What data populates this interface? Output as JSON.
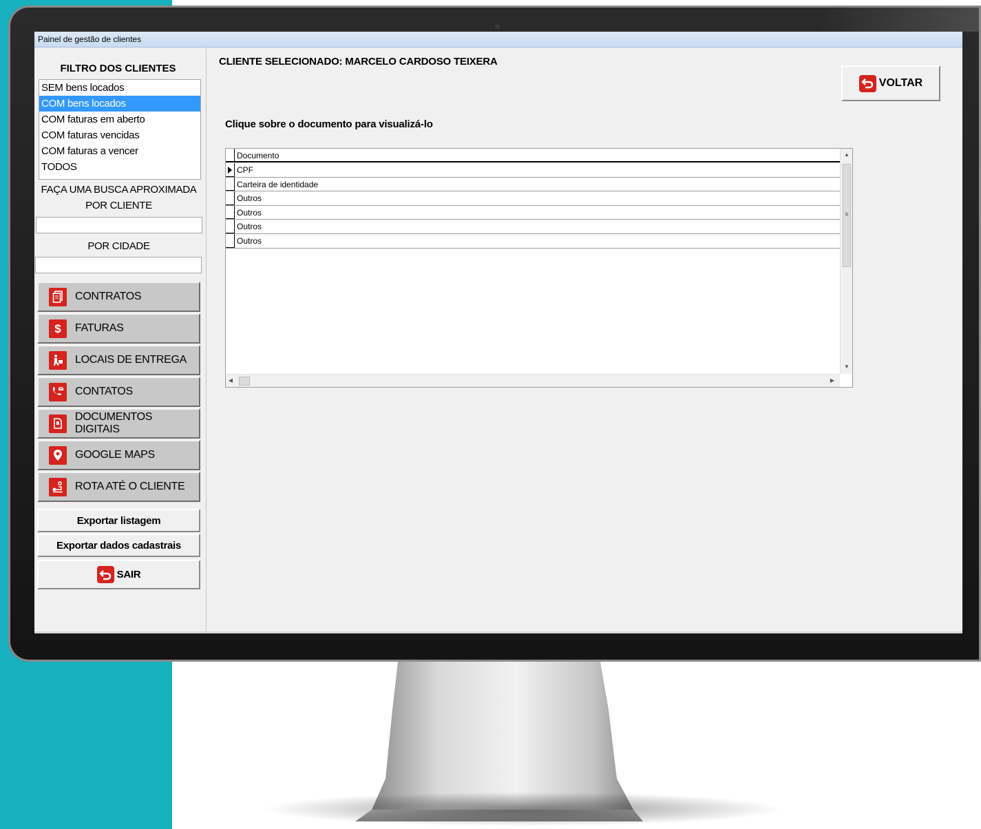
{
  "window": {
    "title": "Painel de gestão de clientes"
  },
  "filter": {
    "title": "FILTRO DOS CLIENTES",
    "items": [
      {
        "label": "SEM bens locados",
        "selected": false
      },
      {
        "label": "COM bens locados",
        "selected": true
      },
      {
        "label": "COM faturas em aberto",
        "selected": false
      },
      {
        "label": "COM faturas vencidas",
        "selected": false
      },
      {
        "label": "COM faturas a vencer",
        "selected": false
      },
      {
        "label": "TODOS",
        "selected": false
      }
    ]
  },
  "search": {
    "label_line1": "FAÇA UMA BUSCA APROXIMADA",
    "label_line2": "POR CLIENTE",
    "client_value": "",
    "city_label": "POR CIDADE",
    "city_value": ""
  },
  "nav": [
    {
      "label": "CONTRATOS",
      "icon": "contract-icon"
    },
    {
      "label": "FATURAS",
      "icon": "dollar-icon"
    },
    {
      "label": "LOCAIS DE ENTREGA",
      "icon": "delivery-icon"
    },
    {
      "label": "CONTATOS",
      "icon": "phone-mail-icon"
    },
    {
      "label": "DOCUMENTOS DIGITAIS",
      "icon": "document-icon"
    },
    {
      "label": "GOOGLE MAPS",
      "icon": "map-pin-icon"
    },
    {
      "label": "ROTA ATÉ O CLIENTE",
      "icon": "route-icon"
    }
  ],
  "actions": {
    "export_list": "Exportar listagem",
    "export_data": "Exportar dados cadastrais",
    "exit": "SAIR"
  },
  "main": {
    "selected_client": "CLIENTE SELECIONADO: MARCELO CARDOSO TEIXERA",
    "back": "VOLTAR",
    "instruction": "Clique sobre o documento para visualizá-lo",
    "grid": {
      "column": "Documento",
      "rows": [
        "CPF",
        "Carteira de identidade",
        "Outros",
        "Outros",
        "Outros",
        "Outros"
      ],
      "current_row": 0
    }
  },
  "colors": {
    "accent_red": "#d5231d",
    "selection_blue": "#3399ff",
    "background_teal": "#17b0bf"
  }
}
